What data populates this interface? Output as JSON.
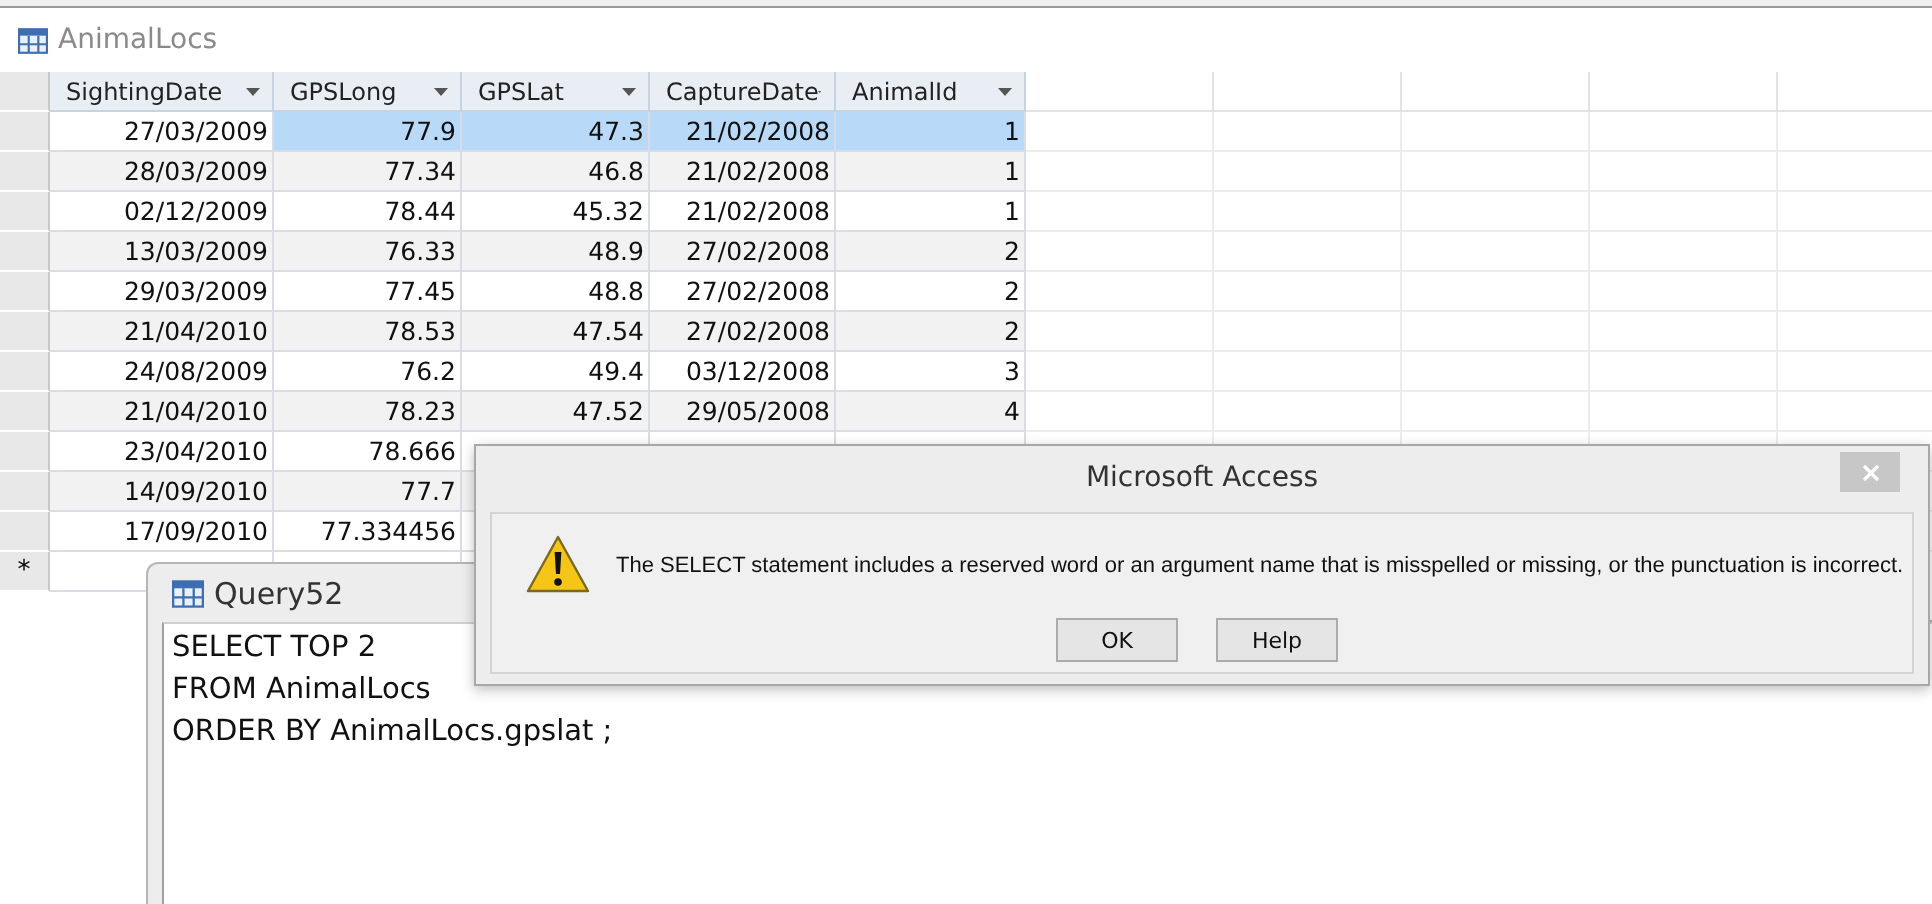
{
  "table_window": {
    "title": "AnimalLocs",
    "columns": [
      "SightingDate",
      "GPSLong",
      "GPSLat",
      "CaptureDatе",
      "AnimalId"
    ],
    "rows": [
      {
        "selected": true,
        "cells": [
          "27/03/2009",
          "77.9",
          "47.3",
          "21/02/2008",
          "1"
        ]
      },
      {
        "selected": false,
        "cells": [
          "28/03/2009",
          "77.34",
          "46.8",
          "21/02/2008",
          "1"
        ]
      },
      {
        "selected": false,
        "cells": [
          "02/12/2009",
          "78.44",
          "45.32",
          "21/02/2008",
          "1"
        ]
      },
      {
        "selected": false,
        "cells": [
          "13/03/2009",
          "76.33",
          "48.9",
          "27/02/2008",
          "2"
        ]
      },
      {
        "selected": false,
        "cells": [
          "29/03/2009",
          "77.45",
          "48.8",
          "27/02/2008",
          "2"
        ]
      },
      {
        "selected": false,
        "cells": [
          "21/04/2010",
          "78.53",
          "47.54",
          "27/02/2008",
          "2"
        ]
      },
      {
        "selected": false,
        "cells": [
          "24/08/2009",
          "76.2",
          "49.4",
          "03/12/2008",
          "3"
        ]
      },
      {
        "selected": false,
        "cells": [
          "21/04/2010",
          "78.23",
          "47.52",
          "29/05/2008",
          "4"
        ]
      },
      {
        "selected": false,
        "cells": [
          "23/04/2010",
          "78.666"
        ]
      },
      {
        "selected": false,
        "cells": [
          "14/09/2010",
          "77.7"
        ]
      },
      {
        "selected": false,
        "cells": [
          "17/09/2010",
          "77.334456"
        ]
      }
    ],
    "new_row_marker": "*"
  },
  "query_window": {
    "title": "Query52",
    "sql_lines": [
      "SELECT TOP 2",
      "FROM AnimalLocs",
      "ORDER BY AnimalLocs.gpslat ;"
    ]
  },
  "dialog": {
    "title": "Microsoft Access",
    "message": "The SELECT statement includes a reserved word or an argument name that is misspelled or missing, or the punctuation is incorrect.",
    "buttons": [
      "OK",
      "Help"
    ]
  }
}
